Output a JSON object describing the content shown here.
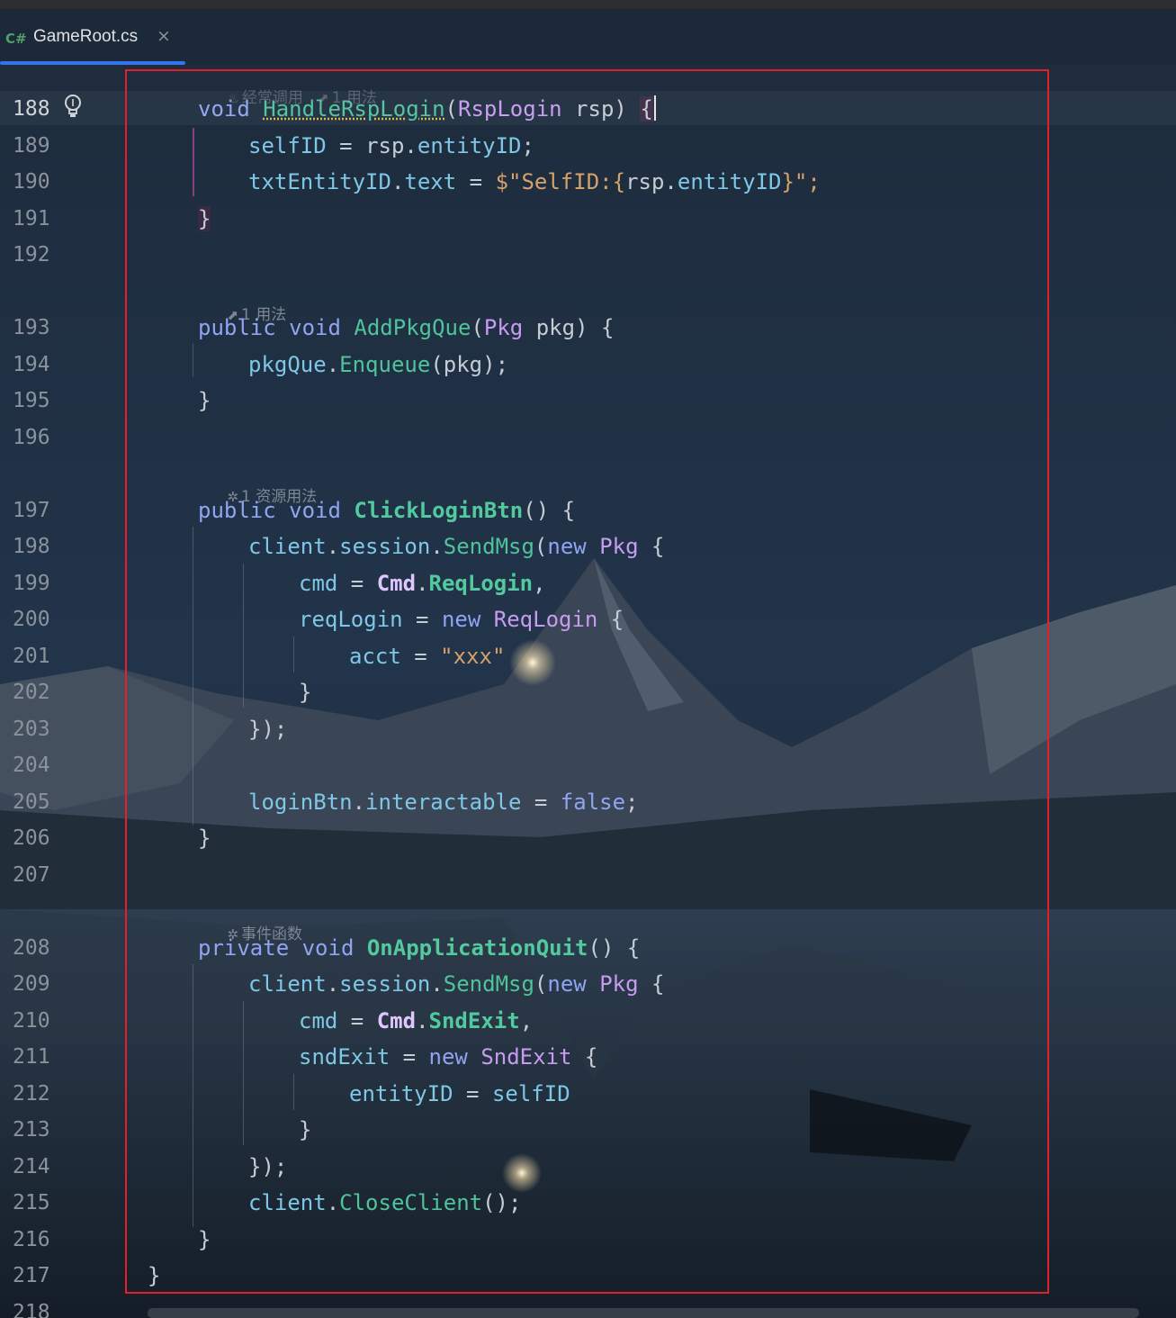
{
  "tab": {
    "lang_badge": "C#",
    "filename": "GameRoot.cs",
    "close_glyph": "×"
  },
  "hints": {
    "h188": "经常调用",
    "h188b": "1 用法",
    "h193": "1 用法",
    "h197": "1 资源用法",
    "h208": "事件函数"
  },
  "lines": {
    "n188": "188",
    "n189": "189",
    "n190": "190",
    "n191": "191",
    "n192": "192",
    "n193": "193",
    "n194": "194",
    "n195": "195",
    "n196": "196",
    "n197": "197",
    "n198": "198",
    "n199": "199",
    "n200": "200",
    "n201": "201",
    "n202": "202",
    "n203": "203",
    "n204": "204",
    "n205": "205",
    "n206": "206",
    "n207": "207",
    "n208": "208",
    "n209": "209",
    "n210": "210",
    "n211": "211",
    "n212": "212",
    "n213": "213",
    "n214": "214",
    "n215": "215",
    "n216": "216",
    "n217": "217",
    "n218": "218"
  },
  "tok": {
    "void": "void",
    "public": "public",
    "private": "private",
    "new": "new",
    "false": "false",
    "HandleRspLogin": "HandleRspLogin",
    "RspLogin": "RspLogin",
    "rsp": "rsp",
    "selfID": "selfID",
    "entityID": "entityID",
    "txtEntityID": "txtEntityID",
    "text": "text",
    "interp_open": "$\"SelfID:",
    "interp_close": "}\";",
    "AddPkgQue": "AddPkgQue",
    "Pkg": "Pkg",
    "pkg": "pkg",
    "pkgQue": "pkgQue",
    "Enqueue": "Enqueue",
    "ClickLoginBtn": "ClickLoginBtn",
    "client": "client",
    "session": "session",
    "SendMsg": "SendMsg",
    "cmd": "cmd",
    "Cmd": "Cmd",
    "ReqLogin": "ReqLogin",
    "reqLogin": "reqLogin",
    "acct": "acct",
    "xxx": "\"xxx\"",
    "loginBtn": "loginBtn",
    "interactable": "interactable",
    "OnApplicationQuit": "OnApplicationQuit",
    "SndExit": "SndExit",
    "sndExit": "sndExit",
    "CloseClient": "CloseClient"
  },
  "colors": {
    "keyword": "#8fa4f2",
    "method": "#4fc39a",
    "type": "#c89bf0",
    "field": "#7fc7e6",
    "string": "#d6a26a",
    "annotation_rect": "#e0202c",
    "tab_underline": "#3574f0"
  },
  "icons": {
    "tab_lang": "csharp-icon",
    "close": "close-icon",
    "bulb": "lightbulb-icon",
    "hot": "flame-icon",
    "usage": "usage-arrow-icon",
    "unity": "unity-icon"
  }
}
